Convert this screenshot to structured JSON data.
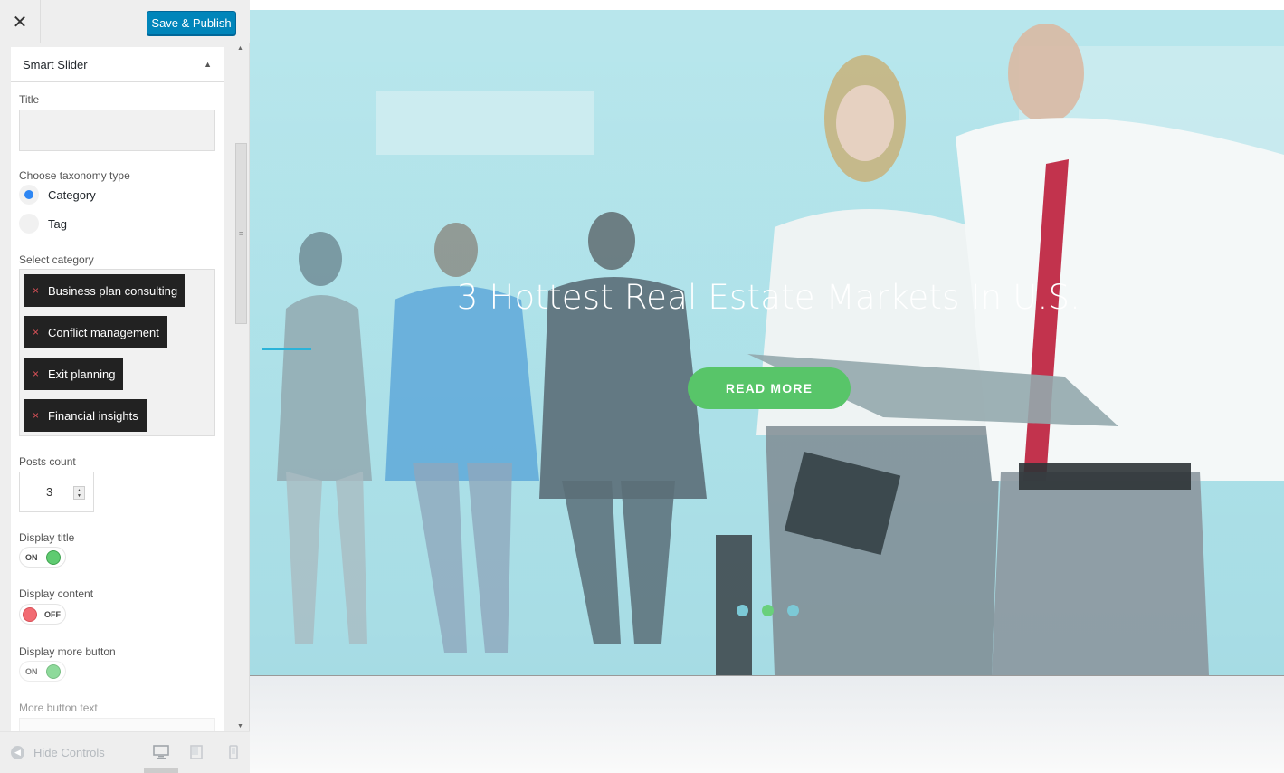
{
  "header": {
    "close_icon": "close-icon",
    "save_label": "Save & Publish"
  },
  "section": {
    "title": "Smart Slider",
    "arrow_icon": "triangle-up-icon"
  },
  "form": {
    "title_label": "Title",
    "title_value": "",
    "taxonomy_label": "Choose taxonomy type",
    "taxonomy_options": [
      {
        "label": "Category",
        "selected": true
      },
      {
        "label": "Tag",
        "selected": false
      }
    ],
    "category_label": "Select category",
    "categories": [
      "Business plan consulting",
      "Conflict management",
      "Exit planning",
      "Financial insights"
    ],
    "tag_remove_symbol": "×",
    "posts_count_label": "Posts count",
    "posts_count_value": "3",
    "display_title_label": "Display title",
    "display_title_state": "ON",
    "display_content_label": "Display content",
    "display_content_state": "OFF",
    "display_more_label": "Display more button",
    "display_more_state": "ON",
    "more_text_label": "More button text"
  },
  "footer": {
    "hide_controls_label": "Hide Controls",
    "devices": [
      "desktop-icon",
      "tablet-icon",
      "mobile-icon"
    ],
    "active_device": "desktop"
  },
  "preview": {
    "slide_title": "3 Hottest Real Estate Markets In U.S.",
    "button_label": "READ MORE",
    "dots": 3,
    "active_dot": 2
  },
  "colors": {
    "primary_button": "#0085ba",
    "radio_selected": "#2d86f3",
    "toggle_on": "#5fcb71",
    "toggle_off": "#f26b72",
    "read_more": "#58c569",
    "hero_overlay": "#9bdee6"
  }
}
